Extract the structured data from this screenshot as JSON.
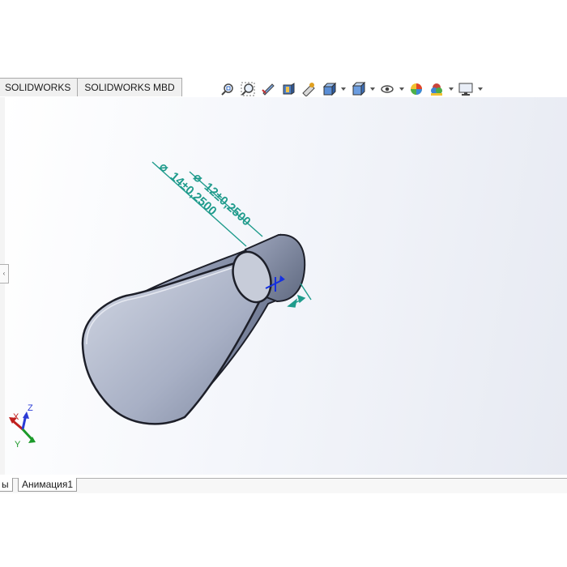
{
  "tabs": [
    {
      "label": "SOLIDWORKS"
    },
    {
      "label": "SOLIDWORKS MBD"
    }
  ],
  "toolbar": {
    "icons": [
      "zoom-to-fit-icon",
      "zoom-to-area-icon",
      "previous-view-icon",
      "section-view-icon",
      "dynamic-annotation-view-icon",
      "view-orientation-icon",
      "display-style-icon",
      "hide-show-items-icon",
      "edit-appearance-icon",
      "apply-scene-icon",
      "view-settings-icon"
    ]
  },
  "dimensions": {
    "outer": "14±0,2500",
    "inner": "12±0,2500",
    "diameter_symbol": "⌀"
  },
  "triad": {
    "x": "X",
    "y": "Y",
    "z": "Z"
  },
  "bottom_tabs": [
    {
      "label": "ы"
    },
    {
      "label": "Анимация1"
    }
  ],
  "colors": {
    "dimension": "#1f9b8c",
    "part_fill": "#a7afc4",
    "part_edge": "#1d1f29"
  }
}
